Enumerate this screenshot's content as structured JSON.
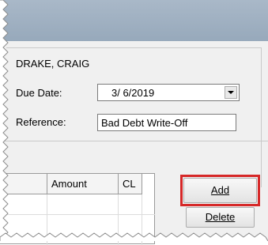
{
  "customer": {
    "name": "DRAKE, CRAIG"
  },
  "due_date": {
    "label": "Due Date:",
    "value": "3/ 6/2019"
  },
  "reference": {
    "label": "Reference:",
    "value": "Bad Debt Write-Off"
  },
  "grid": {
    "columns": [
      "",
      "Amount",
      "CL"
    ]
  },
  "buttons": {
    "add": "Add",
    "delete": "Delete"
  },
  "colors": {
    "highlight": "#d62828",
    "titlebar": "#a9b8c8",
    "window": "#f0f0f0"
  }
}
